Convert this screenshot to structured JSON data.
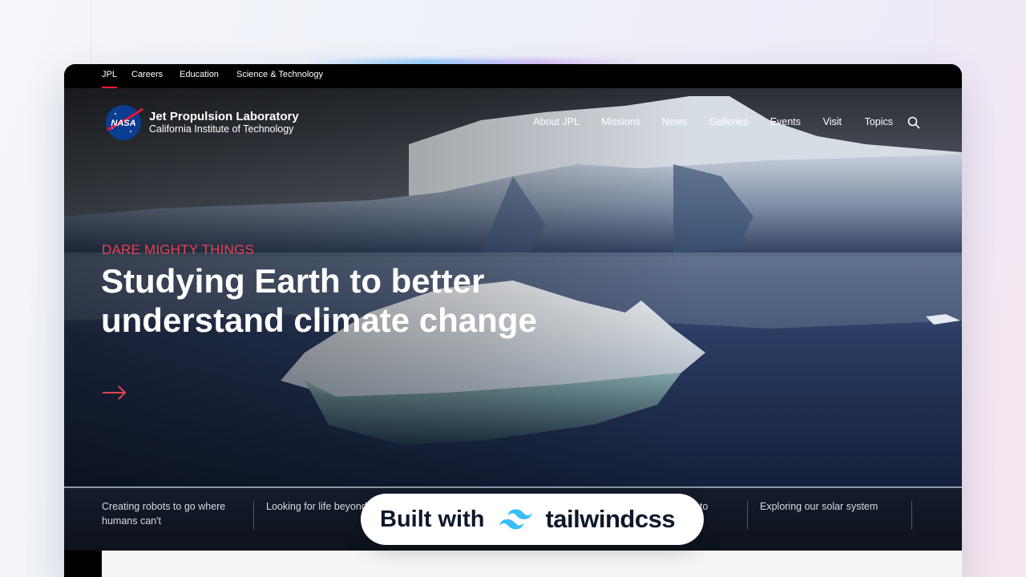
{
  "utility_nav": {
    "items": [
      {
        "label": "JPL",
        "active": true
      },
      {
        "label": "Careers"
      },
      {
        "label": "Education"
      },
      {
        "label": "Science & Technology"
      }
    ]
  },
  "brand": {
    "logo_text": "NASA",
    "title": "Jet Propulsion Laboratory",
    "subtitle": "California Institute of Technology"
  },
  "main_nav": {
    "items": [
      {
        "label": "About JPL"
      },
      {
        "label": "Missions"
      },
      {
        "label": "News"
      },
      {
        "label": "Galleries"
      },
      {
        "label": "Events"
      },
      {
        "label": "Visit"
      },
      {
        "label": "Topics"
      }
    ],
    "search_icon": "search-icon"
  },
  "hero": {
    "eyebrow": "DARE MIGHTY THINGS",
    "headline": "Studying Earth to better understand climate change",
    "link_icon": "arrow-right-icon"
  },
  "topics": [
    {
      "label": "Creating robots to go where humans can't"
    },
    {
      "label": "Looking for life beyond Earth"
    },
    {
      "label": "Developing technology to"
    },
    {
      "label": "Exploring our solar system"
    }
  ],
  "badge": {
    "prefix": "Built with",
    "name": "tailwindcss",
    "logo_icon": "tailwind-logo-icon"
  },
  "colors": {
    "accent_red": "#e31937",
    "eyebrow_red": "#e8424f",
    "tailwind_cyan": "#38bdf8",
    "topics_bg": "#0d121c"
  }
}
